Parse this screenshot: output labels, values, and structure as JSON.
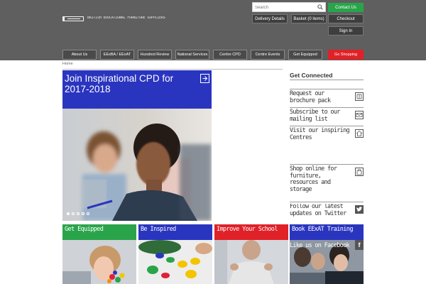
{
  "header": {
    "logo_text": "BRITISH EDUCATIONAL FURNITURE SUPPLIERS",
    "search_placeholder": "Search",
    "contact_label": "Contact Us",
    "delivery_label": "Delivery Details",
    "basket_label": "Basket (0 items)",
    "checkout_label": "Checkout",
    "signin_label": "Sign In",
    "colors": {
      "background": "#5f5f5f",
      "contact": "#2aa44a",
      "shop": "#e02128"
    }
  },
  "nav": {
    "items": [
      {
        "label": "About Us"
      },
      {
        "label": "EExBA / EExAT"
      },
      {
        "label": "Hundred Review"
      },
      {
        "label": "National Services"
      },
      {
        "label": "Centre CPD"
      },
      {
        "label": "Centre Events"
      },
      {
        "label": "Get Equipped"
      },
      {
        "label": "Go Shopping"
      }
    ]
  },
  "breadcrumb": {
    "home": "Home"
  },
  "hero": {
    "title": "Join Inspirational CPD for 2017-2018",
    "arrow_icon": "arrow-right-icon",
    "slide_count": 5,
    "active_slide": 1,
    "title_color": "#2a35bf"
  },
  "sidebar": {
    "title": "Get Connected",
    "items": [
      {
        "label": "Request our brochure pack",
        "icon": "book-icon"
      },
      {
        "label": "Subscribe to our mailing list",
        "icon": "envelope-icon"
      },
      {
        "label": "Visit our inspiring Centres",
        "icon": "home-icon"
      },
      {
        "label": "Shop online for furniture, resources and storage",
        "icon": "shopping-bag-icon"
      },
      {
        "label": "Follow our latest updates on Twitter",
        "icon": "twitter-icon"
      }
    ]
  },
  "tiles": [
    {
      "label": "Get Equipped",
      "color": "#2aa44a"
    },
    {
      "label": "Be Inspired",
      "color": "#2a35bf"
    },
    {
      "label": "Improve Your School",
      "color": "#e02128"
    },
    {
      "label": "Book EExAT Training",
      "color": "#2a35bf"
    }
  ],
  "social": {
    "facebook_label": "Like us on Facebook",
    "facebook_glyph": "f"
  }
}
